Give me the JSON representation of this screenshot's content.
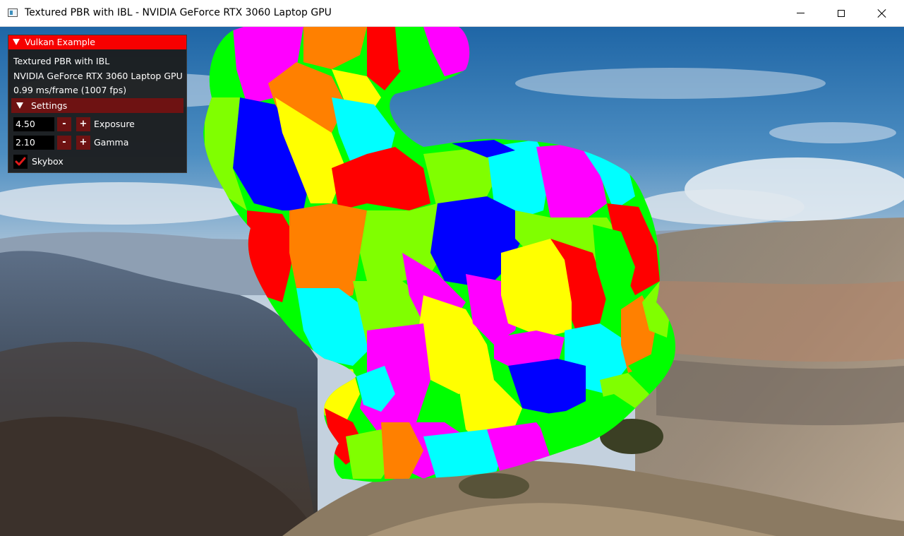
{
  "window": {
    "title": "Textured PBR with IBL - NVIDIA GeForce RTX 3060 Laptop GPU"
  },
  "overlay": {
    "header": "Vulkan Example",
    "app_name": "Textured PBR with IBL",
    "gpu_name": "NVIDIA GeForce RTX 3060 Laptop GPU",
    "frame_stats": "0.99 ms/frame (1007 fps)",
    "settings": {
      "header": "Settings",
      "exposure": {
        "value": "4.50",
        "label": "Exposure",
        "minus": "-",
        "plus": "+"
      },
      "gamma": {
        "value": "2.10",
        "label": "Gamma",
        "minus": "-",
        "plus": "+"
      },
      "skybox": {
        "label": "Skybox",
        "checked": true
      }
    }
  },
  "colors": {
    "accent": "#f70000",
    "frame_bg": "#6e1212",
    "check": "#e11a1a",
    "patch_palette": [
      "#ff00ff",
      "#ffff00",
      "#00ff00",
      "#0000ff",
      "#ff0000",
      "#00ffff",
      "#ff8000",
      "#80ff00"
    ]
  }
}
